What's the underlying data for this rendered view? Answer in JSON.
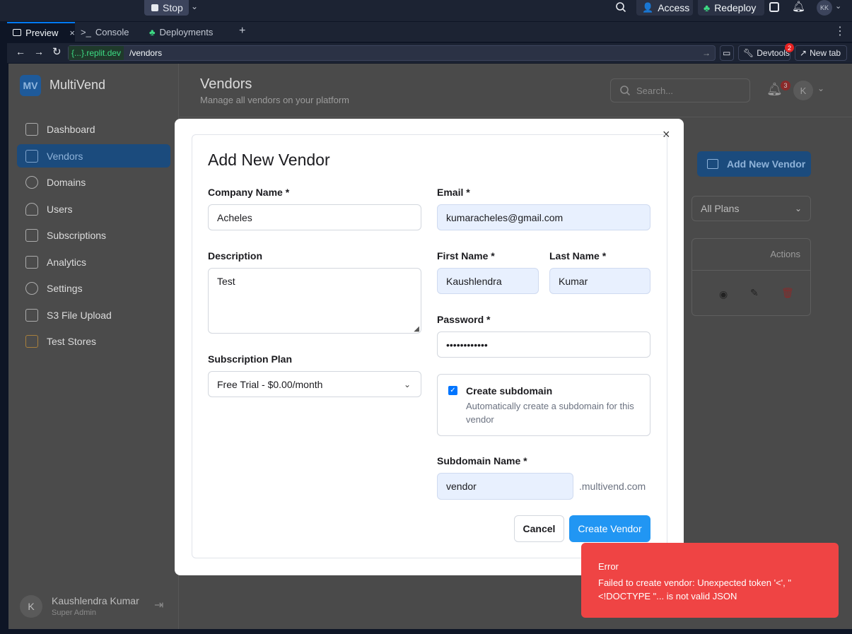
{
  "topbar": {
    "stop_label": "Stop",
    "access_label": "Access",
    "redeploy_label": "Redeploy",
    "user_initials": "KK"
  },
  "tabs": [
    {
      "label": "Preview"
    },
    {
      "label": "Console"
    },
    {
      "label": "Deployments"
    }
  ],
  "url": {
    "domain": "{...}.replit.dev",
    "path": "/vendors",
    "devtools_label": "Devtools",
    "devtools_badge": "2",
    "newtab_label": "New tab"
  },
  "sidebar": {
    "logo": "MV",
    "brand": "MultiVend",
    "items": [
      {
        "label": "Dashboard"
      },
      {
        "label": "Vendors"
      },
      {
        "label": "Domains"
      },
      {
        "label": "Users"
      },
      {
        "label": "Subscriptions"
      },
      {
        "label": "Analytics"
      },
      {
        "label": "Settings"
      },
      {
        "label": "S3 File Upload"
      },
      {
        "label": "Test Stores"
      }
    ],
    "user": {
      "initial": "K",
      "name": "Kaushlendra Kumar",
      "role": "Super Admin"
    }
  },
  "header": {
    "title": "Vendors",
    "subtitle": "Manage all vendors on your platform",
    "search_placeholder": "Search...",
    "notif_count": "3",
    "avatar": "K"
  },
  "background": {
    "add_vendor": "Add New Vendor",
    "plan_filter": "All Plans",
    "actions_header": "Actions"
  },
  "modal": {
    "title": "Add New Vendor",
    "company_label": "Company Name *",
    "company_value": "Acheles",
    "email_label": "Email *",
    "email_value": "kumaracheles@gmail.com",
    "description_label": "Description",
    "description_value": "Test",
    "first_label": "First Name *",
    "first_value": "Kaushlendra",
    "last_label": "Last Name *",
    "last_value": "Kumar",
    "password_label": "Password *",
    "password_value": "••••••••••••",
    "plan_label": "Subscription Plan",
    "plan_value": "Free Trial - $0.00/month",
    "subdomain_check_title": "Create subdomain",
    "subdomain_check_desc": "Automatically create a subdomain for this vendor",
    "subdomain_label": "Subdomain Name *",
    "subdomain_value": "vendor",
    "subdomain_suffix": ".multivend.com",
    "cancel": "Cancel",
    "create": "Create Vendor"
  },
  "toast": {
    "title": "Error",
    "message": "Failed to create vendor: Unexpected token '<', \"<!DOCTYPE \"... is not valid JSON"
  }
}
